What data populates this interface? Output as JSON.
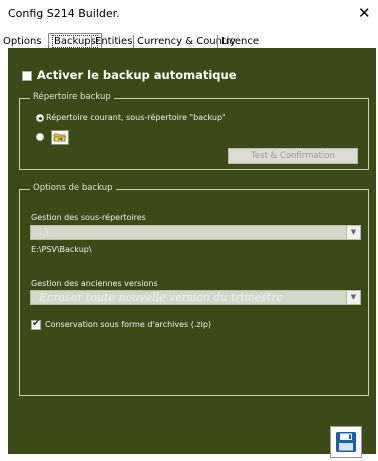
{
  "window": {
    "title": "Config S214 Builder.",
    "close_glyph": "✕"
  },
  "tabs": [
    {
      "label": "Options"
    },
    {
      "label": "Backups"
    },
    {
      "label": "Entities"
    },
    {
      "label": "Currency & Country"
    },
    {
      "label": "Licence"
    }
  ],
  "active_tab": "Backups",
  "backup": {
    "auto_label": "Activer le backup automatique",
    "auto_checked": false,
    "dir_group": {
      "title": "Répertoire backup",
      "radio_current_label": "Répertoire courant, sous-répertoire \"backup\"",
      "radio_current_selected": true,
      "radio_custom_selected": false,
      "folder_icon": "folder-open-icon",
      "test_button_label": "Test & Confirmation"
    },
    "options_group": {
      "title": "Options de backup",
      "subdir_label": "Gestion des sous-répertoires",
      "subdir_value": "..\\",
      "path_text": "E:\\PSV\\Backup\\",
      "versions_label": "Gestion des anciennes versions",
      "versions_value": "Ecraser toute nouvelle version du trimestre",
      "zip_label": "Conservation sous forme d'archives (.zip)",
      "zip_checked": true
    },
    "save_icon": "floppy-disk-icon"
  },
  "colors": {
    "panel_bg": "#3b4a17",
    "save_blue": "#1a5fb4"
  }
}
